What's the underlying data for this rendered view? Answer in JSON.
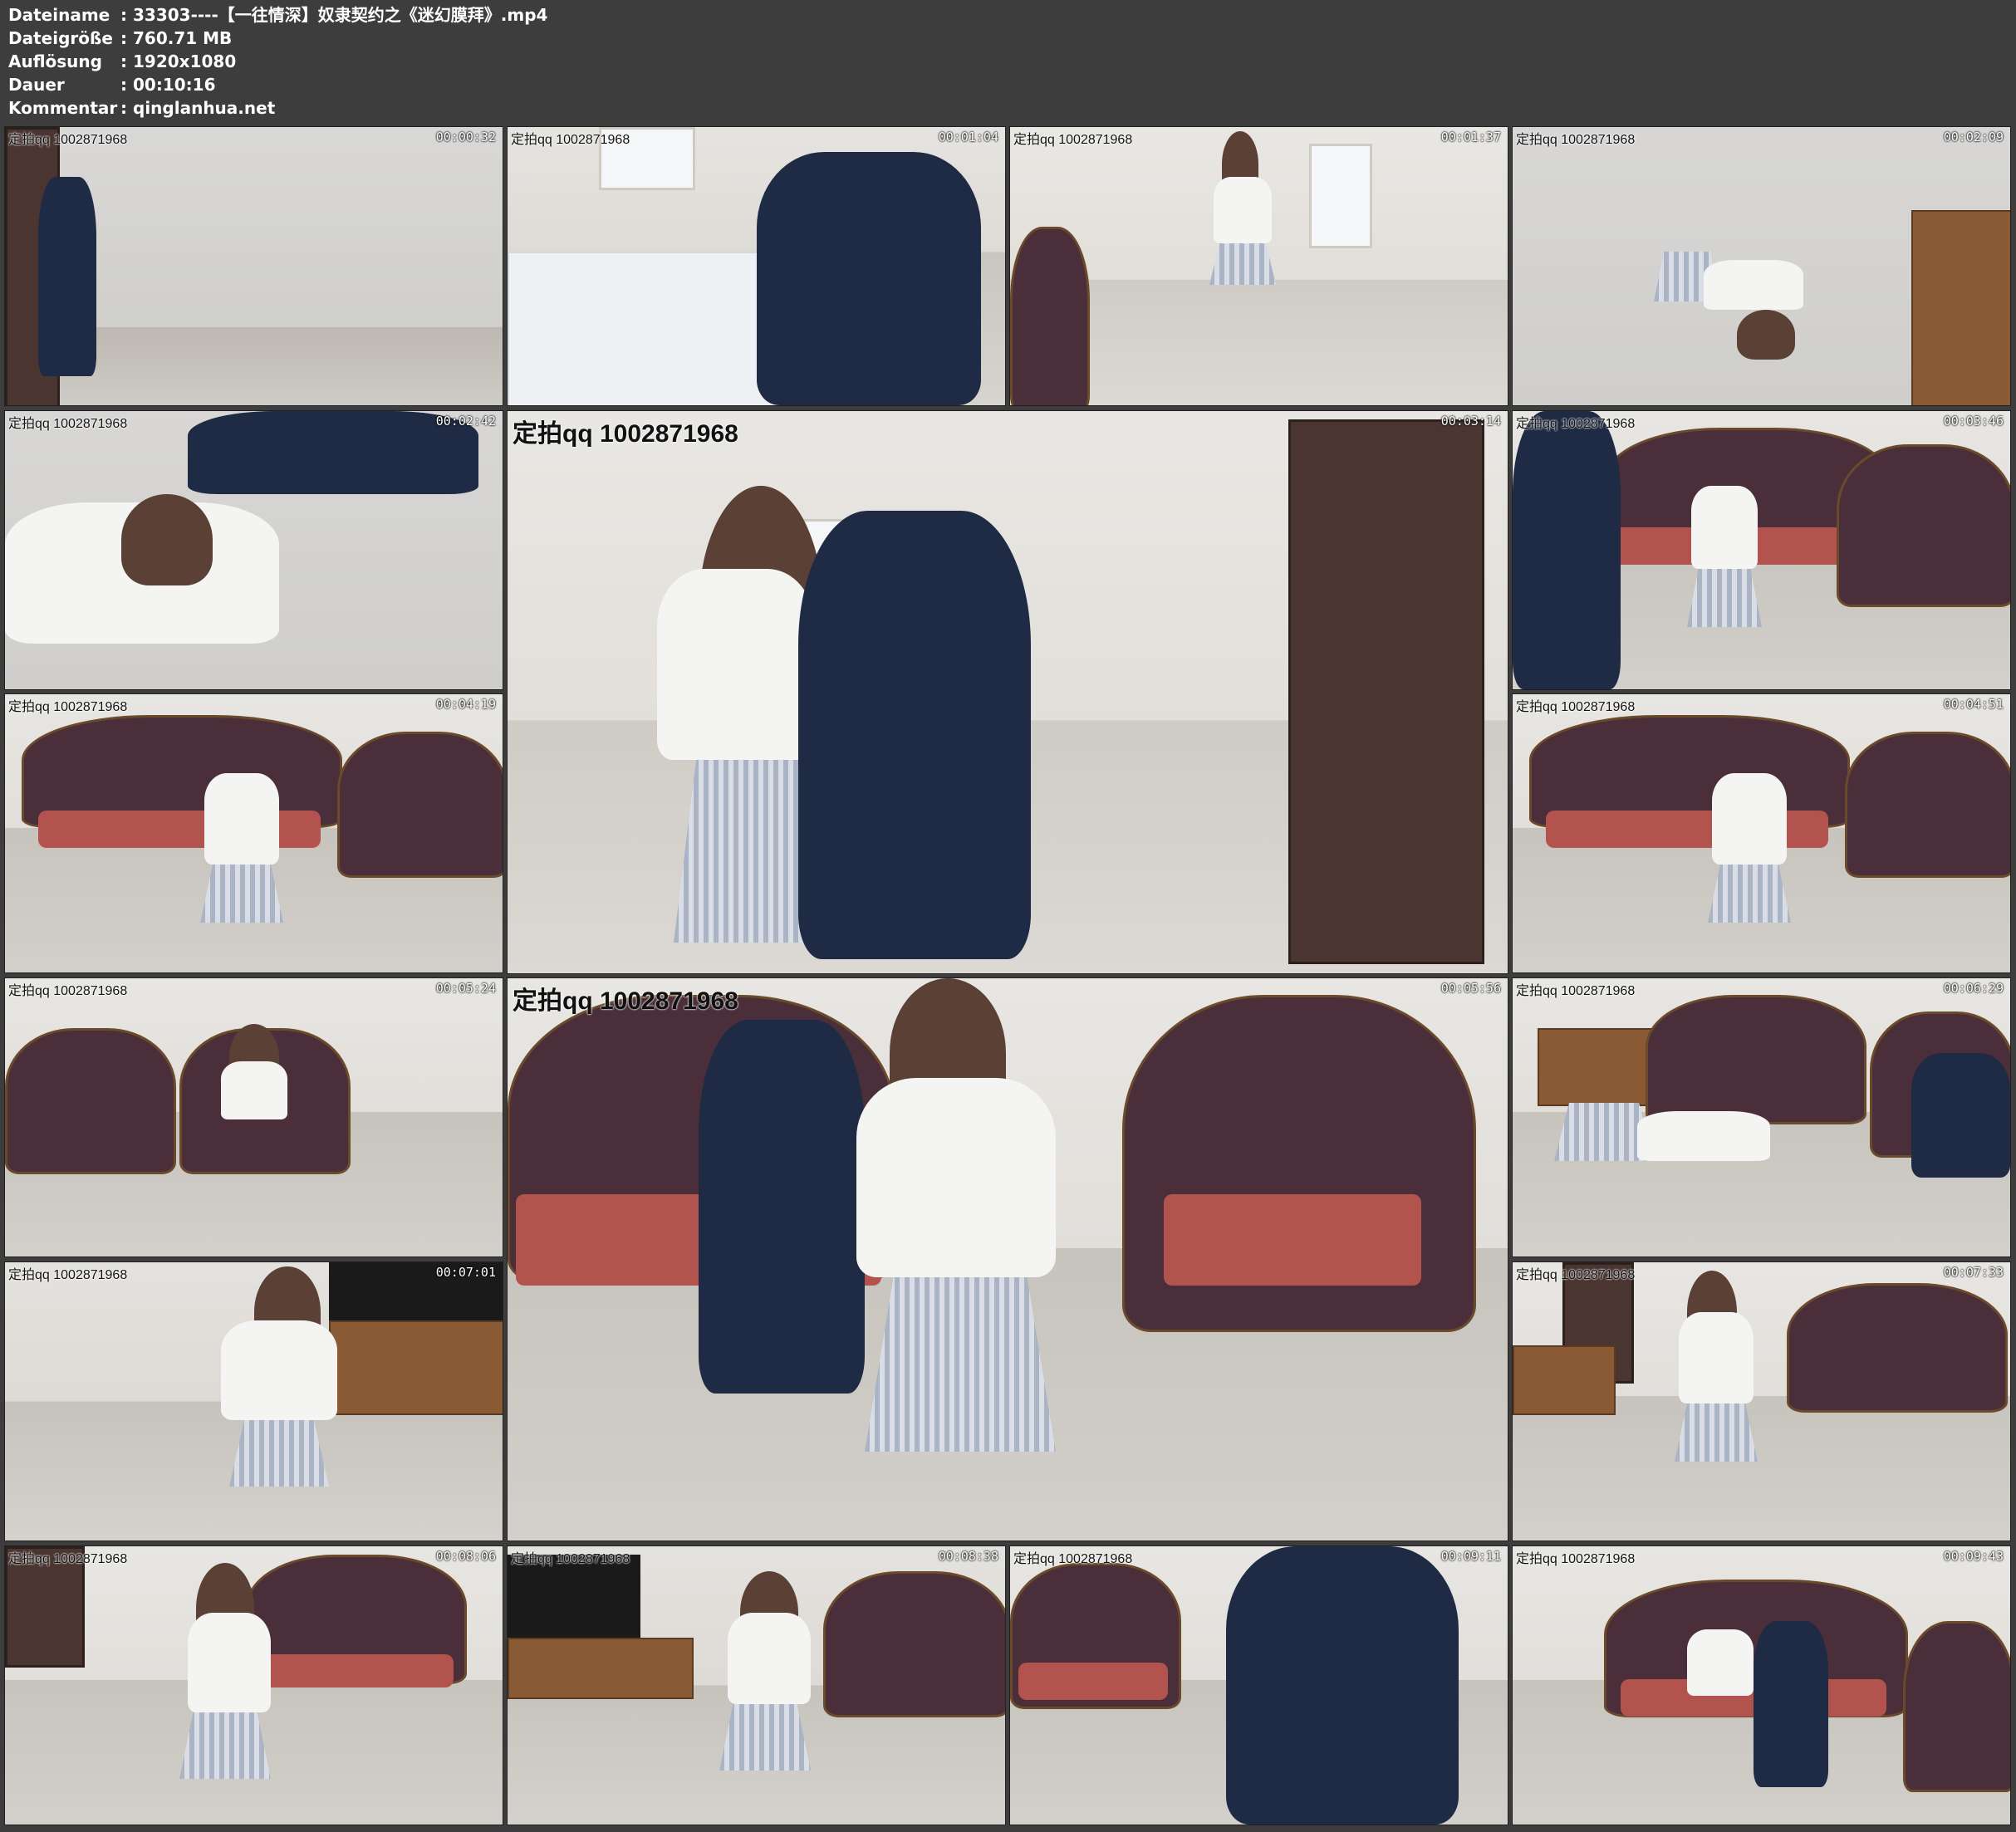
{
  "header": {
    "rows": [
      {
        "key": "Dateiname",
        "sep": ":",
        "value": "33303----【一往情深】奴隶契约之《迷幻膜拜》.mp4"
      },
      {
        "key": "Dateigröße",
        "sep": ":",
        "value": "760.71 MB"
      },
      {
        "key": "Auflösung",
        "sep": ":",
        "value": "1920x1080"
      },
      {
        "key": "Dauer",
        "sep": ":",
        "value": "00:10:16"
      },
      {
        "key": "Kommentar",
        "sep": ":",
        "value": "qinglanhua.net"
      }
    ]
  },
  "watermark": "定拍qq 1002871968",
  "thumbnails": [
    {
      "time": "00:00:32",
      "scene": "wall"
    },
    {
      "time": "00:01:04",
      "scene": "dining"
    },
    {
      "time": "00:01:37",
      "scene": "hall"
    },
    {
      "time": "00:02:09",
      "scene": "floor"
    },
    {
      "time": "00:02:42",
      "scene": "floor"
    },
    {
      "time": "00:03:14",
      "scene": "hall"
    },
    {
      "time": "00:03:46",
      "scene": "sofa"
    },
    {
      "time": "00:04:19",
      "scene": "sofa"
    },
    {
      "time": "00:04:51",
      "scene": "sofa"
    },
    {
      "time": "00:05:24",
      "scene": "sofa"
    },
    {
      "time": "00:05:56",
      "scene": "sofa"
    },
    {
      "time": "00:06:29",
      "scene": "sofa"
    },
    {
      "time": "00:07:01",
      "scene": "tv"
    },
    {
      "time": "00:07:33",
      "scene": "sofa"
    },
    {
      "time": "00:08:06",
      "scene": "sofa"
    },
    {
      "time": "00:08:38",
      "scene": "tv"
    },
    {
      "time": "00:09:11",
      "scene": "sofa"
    },
    {
      "time": "00:09:43",
      "scene": "sofa"
    }
  ],
  "colors": {
    "background": "#3d3d3d",
    "header_text": "#ffffff",
    "sofa_leather": "#4a2f3a",
    "sofa_cushion": "#b2534e",
    "suit": "#1f2a44"
  }
}
